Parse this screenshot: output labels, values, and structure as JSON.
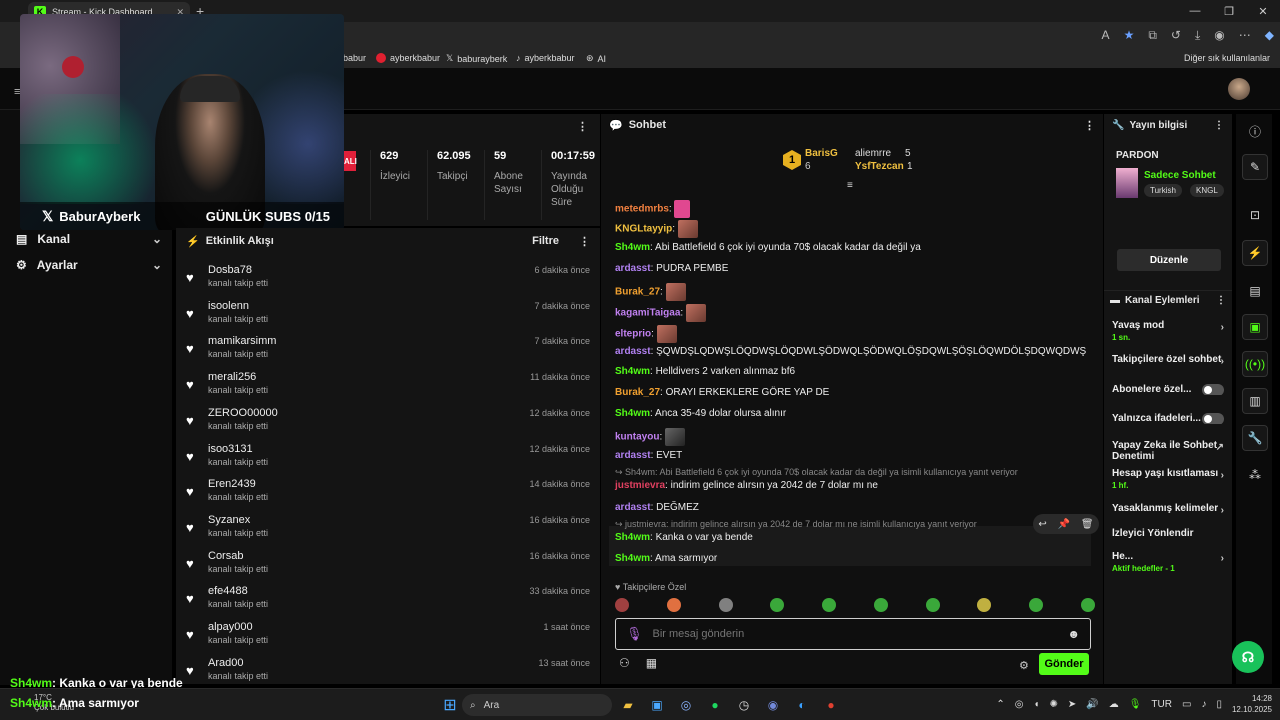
{
  "browser": {
    "tab_title": "Stream - Kick Dashboard",
    "bookmarks": [
      "babur",
      "ayberkbabur",
      "baburayberk",
      "ayberkbabur",
      "AI"
    ],
    "other_bookmarks": "Diğer sık kullanılanlar"
  },
  "webcam": {
    "name": "BaburAyberk",
    "subs_goal": "GÜNLÜK SUBS 0/15"
  },
  "sidebar": {
    "items": [
      {
        "label": "Kanal",
        "icon": "channel-icon"
      },
      {
        "label": "Ayarlar",
        "icon": "gear-icon"
      }
    ]
  },
  "stats": {
    "live_tag": "ALI",
    "items": [
      {
        "value": "629",
        "label": "İzleyici"
      },
      {
        "value": "62.095",
        "label": "Takipçi"
      },
      {
        "value": "59",
        "label": "Abone Sayısı"
      },
      {
        "value": "00:17:59",
        "label": "Yayında Olduğu Süre"
      }
    ]
  },
  "feed": {
    "title": "Etkinlik Akışı",
    "filter": "Filtre",
    "items": [
      {
        "name": "Dosba78",
        "action": "kanalı takip etti",
        "time": "6 dakika önce"
      },
      {
        "name": "isoolenn",
        "action": "kanalı takip etti",
        "time": "7 dakika önce"
      },
      {
        "name": "mamikarsimm",
        "action": "kanalı takip etti",
        "time": "7 dakika önce"
      },
      {
        "name": "merali256",
        "action": "kanalı takip etti",
        "time": "11 dakika önce"
      },
      {
        "name": "ZEROO00000",
        "action": "kanalı takip etti",
        "time": "12 dakika önce"
      },
      {
        "name": "isoo3131",
        "action": "kanalı takip etti",
        "time": "12 dakika önce"
      },
      {
        "name": "Eren2439",
        "action": "kanalı takip etti",
        "time": "14 dakika önce"
      },
      {
        "name": "Syzanex",
        "action": "kanalı takip etti",
        "time": "16 dakika önce"
      },
      {
        "name": "Corsab",
        "action": "kanalı takip etti",
        "time": "16 dakika önce"
      },
      {
        "name": "efe4488",
        "action": "kanalı takip etti",
        "time": "33 dakika önce"
      },
      {
        "name": "alpay000",
        "action": "kanalı takip etti",
        "time": "1 saat önce"
      },
      {
        "name": "Arad00",
        "action": "kanalı takip etti",
        "time": "13 saat önce"
      }
    ]
  },
  "chat": {
    "title": "Sohbet",
    "leaders": {
      "first_name": "BarisG",
      "first_count": "6",
      "second_name": "aliemrre",
      "second_count": "5",
      "third_name": "YsfTezcan",
      "third_count": "1",
      "rank": "1"
    },
    "messages": [
      {
        "user": "metedmrbs",
        "text": "",
        "color": "#f08040",
        "emote": "pink"
      },
      {
        "user": "KNGLtayyip",
        "text": "",
        "color": "#f0c040",
        "emote": "face"
      },
      {
        "user": "Sh4wm",
        "text": "Abi Battlefield 6 çok iyi oyunda 70$ olacak kadar da değil ya",
        "color": "#53fc18"
      },
      {
        "user": "ardasst",
        "text": "PUDRA PEMBE",
        "color": "#b080f0"
      },
      {
        "user": "Burak_27",
        "text": "",
        "color": "#f0a030",
        "emote": "face"
      },
      {
        "user": "kagamiTaigaa",
        "text": "",
        "color": "#c080f0",
        "emote": "face"
      },
      {
        "user": "elteprio",
        "text": "",
        "color": "#c080f0",
        "emote": "face"
      },
      {
        "user": "ardasst",
        "text": "ŞQWDŞLQDWŞLÖQDWŞLÖQDWLŞÖDWQLŞÖDWQLÖŞDQWLŞÖŞLÖQWDÖLŞDQWQDWŞ",
        "color": "#b080f0"
      },
      {
        "user": "Sh4wm",
        "text": "Helldivers 2 varken alınmaz bf6",
        "color": "#53fc18"
      },
      {
        "user": "Burak_27",
        "text": "ORAYI ERKEKLERE GÖRE YAP DE",
        "color": "#f0a030"
      },
      {
        "user": "Sh4wm",
        "text": "Anca 35-49 dolar olursa alınır",
        "color": "#53fc18"
      },
      {
        "user": "kuntayou",
        "text": "",
        "color": "#c080f0",
        "emote": "dark"
      },
      {
        "user": "ardasst",
        "text": "EVET",
        "color": "#b080f0"
      },
      {
        "user": "justmievra",
        "text": "indirim gelince alırsın ya 2042 de 7 dolar mı ne",
        "color": "#e04060",
        "reply": "Sh4wm: Abi Battlefield 6 çok iyi oyunda 70$ olacak kadar da değil ya isimli kullanıcıya yanıt veriyor"
      },
      {
        "user": "ardasst",
        "text": "DEĞMEZ",
        "color": "#b080f0"
      },
      {
        "user": "Sh4wm",
        "text": "Kanka o var ya bende",
        "color": "#53fc18",
        "reply": "justmievra: indirim gelince alırsın ya 2042 de 7 dolar mı ne isimli kullanıcıya yanıt veriyor"
      },
      {
        "user": "Sh4wm",
        "text": "Ama sarmıyor",
        "color": "#53fc18"
      }
    ],
    "followers_only": "Takipçilere Özel",
    "input_placeholder": "Bir mesaj gönderin",
    "send_label": "Gönder"
  },
  "stream_info": {
    "title": "Yayın bilgisi",
    "stream_title": "PARDON",
    "category": "Sadece Sohbet",
    "tags": [
      "Turkish",
      "KNGL"
    ],
    "edit_label": "Düzenle"
  },
  "channel_actions": {
    "title": "Kanal Eylemleri",
    "rows": [
      {
        "label": "Yavaş mod",
        "sub": "1 sn.",
        "type": "arrow"
      },
      {
        "label": "Takipçilere özel sohbet",
        "sub": "",
        "type": "arrow"
      },
      {
        "label": "Abonelere özel...",
        "sub": "",
        "type": "toggle"
      },
      {
        "label": "Yalnızca ifadeleri...",
        "sub": "",
        "type": "toggle"
      },
      {
        "label": "Yapay Zeka ile Sohbet Denetimi",
        "sub": "",
        "type": "link"
      },
      {
        "label": "Hesap yaşı kısıtlaması",
        "sub": "1 hf.",
        "type": "arrow"
      },
      {
        "label": "Yasaklanmış kelimeler",
        "sub": "",
        "type": "arrow"
      },
      {
        "label": "İzleyici Yönlendir",
        "sub": "",
        "type": "none"
      },
      {
        "label": "He...",
        "sub": "Aktif hedefler - 1",
        "type": "arrow"
      }
    ]
  },
  "overlay_chat": [
    {
      "user": "Sh4wm",
      "text": ": Kanka o var ya bende"
    },
    {
      "user": "Sh4wm",
      "text": ": Ama sarmıyor"
    }
  ],
  "taskbar": {
    "weather_temp": "17°C",
    "weather_desc": "Çok bulutlu",
    "search": "Ara",
    "lang": "TUR",
    "time": "14:28",
    "date": "12.10.2025"
  },
  "colors": {
    "kick_green": "#53fc18",
    "panel": "#141414",
    "background": "#000000"
  }
}
